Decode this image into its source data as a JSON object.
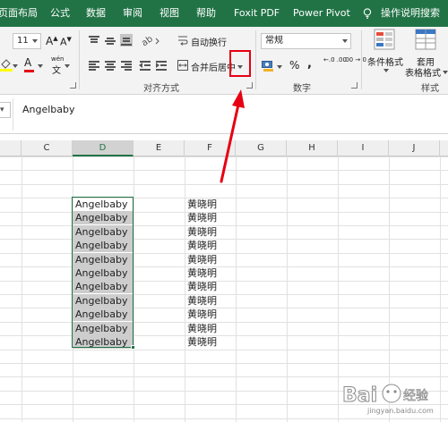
{
  "ribbon_tabs": {
    "page_layout": "页面布局",
    "formulas": "公式",
    "data": "数据",
    "review": "审阅",
    "view": "视图",
    "help": "帮助",
    "foxit": "Foxit PDF",
    "power_pivot": "Power Pivot",
    "tell_me": "操作说明搜索"
  },
  "font_group": {
    "font_size": "11",
    "grow_font": "A",
    "shrink_font": "A",
    "font_color_letter": "A",
    "pinyin": "wén"
  },
  "alignment_group": {
    "wrap_text": "自动换行",
    "merge_center": "合并后居中",
    "label": "对齐方式"
  },
  "number_group": {
    "format": "常规",
    "percent": "%",
    "comma": ",",
    "inc_decimal": "←.0 .00",
    "dec_decimal": ".00 →.0",
    "label": "数字"
  },
  "styles_group": {
    "conditional_formatting": "条件格式",
    "format_as_table_line1": "套用",
    "format_as_table_line2": "表格格式",
    "label": "样式"
  },
  "formula_bar": {
    "content": "Angelbaby"
  },
  "columns": [
    "C",
    "D",
    "E",
    "F",
    "G",
    "H",
    "I",
    "J"
  ],
  "sheet": {
    "column_d": [
      "Angelbaby",
      "Angelbaby",
      "Angelbaby",
      "Angelbaby",
      "Angelbaby",
      "Angelbaby",
      "Angelbaby",
      "Angelbaby",
      "Angelbaby",
      "Angelbaby",
      "Angelbaby"
    ],
    "column_f": [
      "黄晓明",
      "黄晓明",
      "黄晓明",
      "黄晓明",
      "黄晓明",
      "黄晓明",
      "黄晓明",
      "黄晓明",
      "黄晓明",
      "黄晓明",
      "黄晓明"
    ]
  },
  "watermark": {
    "text": "Bai",
    "subtext": "经验",
    "url": "jingyan.baidu.com"
  },
  "colors": {
    "excel_green": "#217346",
    "highlight_red": "#e60012",
    "selection_gray": "#cdcdcd"
  }
}
